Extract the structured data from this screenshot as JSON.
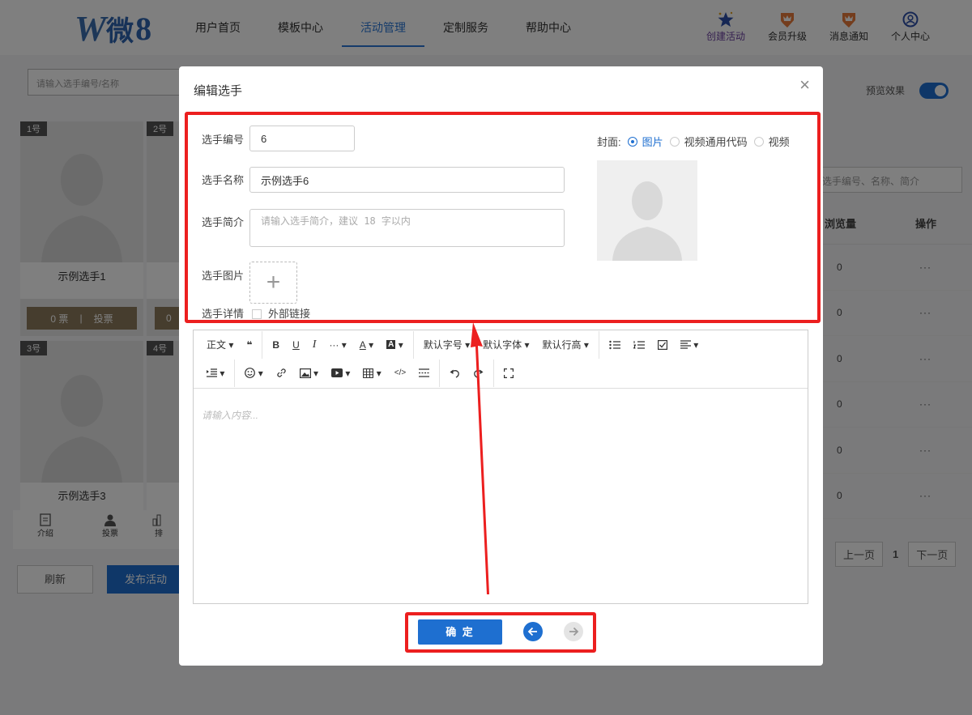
{
  "header": {
    "logo_w": "W",
    "logo_wei": "微",
    "logo_num": "8",
    "menu": [
      {
        "label": "用户首页"
      },
      {
        "label": "模板中心"
      },
      {
        "label": "活动管理"
      },
      {
        "label": "定制服务"
      },
      {
        "label": "帮助中心"
      }
    ],
    "icons": [
      {
        "label": "创建活动",
        "icon": "star-icon"
      },
      {
        "label": "会员升级",
        "icon": "crown-icon"
      },
      {
        "label": "消息通知",
        "icon": "bell-icon"
      },
      {
        "label": "个人中心",
        "icon": "user-icon"
      }
    ]
  },
  "background": {
    "search_placeholder": "请输入选手编号/名称",
    "cards": [
      {
        "badge": "1号",
        "name": "示例选手1",
        "votes": "0 票",
        "sep": "|",
        "vote_btn": "投票"
      },
      {
        "badge": "2号",
        "votes": "0"
      },
      {
        "badge": "3号",
        "name": "示例选手3"
      },
      {
        "badge": "4号"
      }
    ],
    "tabs": [
      {
        "label": "介绍",
        "icon": "document-icon"
      },
      {
        "label": "投票",
        "icon": "user-icon"
      },
      {
        "label": "排",
        "icon": "ranking-icon"
      }
    ],
    "refresh": "刷新",
    "publish": "发布活动",
    "preview_label": "预览效果",
    "right_search": "选手编号、名称、简介",
    "table_headers": {
      "views": "浏览量",
      "ops": "操作"
    },
    "table_rows": [
      {
        "views": "0",
        "ops": "···"
      },
      {
        "views": "0",
        "ops": "···"
      },
      {
        "views": "0",
        "ops": "···"
      },
      {
        "views": "0",
        "ops": "···"
      },
      {
        "views": "0",
        "ops": "···"
      },
      {
        "views": "0",
        "ops": "···"
      }
    ],
    "pager": {
      "prev": "上一页",
      "page": "1",
      "next": "下一页"
    }
  },
  "modal": {
    "title": "编辑选手",
    "close": "×",
    "fields": {
      "number_label": "选手编号",
      "number_value": "6",
      "name_label": "选手名称",
      "name_value": "示例选手6",
      "intro_label": "选手简介",
      "intro_placeholder": "请输入选手简介，建议 18 字以内",
      "image_label": "选手图片",
      "image_upload": "+",
      "detail_label": "选手详情",
      "external_link": "外部链接"
    },
    "cover": {
      "label": "封面:",
      "options": [
        {
          "label": "图片",
          "selected": true
        },
        {
          "label": "视频通用代码",
          "selected": false
        },
        {
          "label": "视频",
          "selected": false
        }
      ]
    },
    "toolbar": {
      "heading": "正文",
      "quote": "❝",
      "bold": "B",
      "underline": "U",
      "italic": "I",
      "more": "···",
      "font_color": "A",
      "bg_color": "A",
      "font_size": "默认字号",
      "font_family": "默认字体",
      "line_height": "默认行高"
    },
    "editor_placeholder": "请输入内容...",
    "confirm": "确 定"
  },
  "colors": {
    "accent": "#1e6fd0",
    "highlight": "#ec1f1f",
    "vote_button": "#8d7b5c"
  }
}
